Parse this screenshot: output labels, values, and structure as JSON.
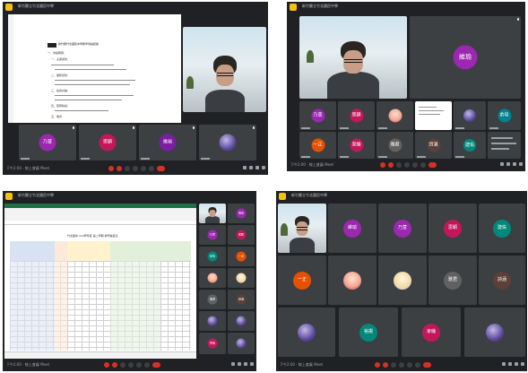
{
  "meeting": {
    "title": "新竹縣立竹北國民中學",
    "bottom_label": "下午2:00 · 線上會議 Meet"
  },
  "panels": [
    {
      "tiles": [
        {
          "initial": "乃萱",
          "color": "#9c27b0"
        },
        {
          "initial": "思穎",
          "color": "#c2185b"
        },
        {
          "initial": "維瑜",
          "color": "#7b1fa2"
        }
      ],
      "document": {
        "heading": "新竹縣竹北國民中學教學會議紀錄",
        "subheading": "一、會議時間：",
        "lines": [
          "一、主席報告：",
          "二、業務報告：",
          "三、提案討論：",
          "四、臨時動議：",
          "五、散會"
        ]
      }
    },
    {
      "big_tile": {
        "initial": "維瑜",
        "color": "#9c27b0"
      },
      "tiles": [
        {
          "initial": "乃萱",
          "color": "#9c27b0"
        },
        {
          "initial": "思穎",
          "color": "#c2185b"
        },
        {
          "initial": "一正",
          "color": "#e65100"
        },
        {
          "initial": "家綸",
          "color": "#c2185b"
        },
        {
          "initial": "雅君",
          "color": "#616161"
        },
        {
          "initial": "詩涵",
          "color": "#5d4037"
        },
        {
          "initial": "建佑",
          "color": "#00897b"
        },
        {
          "initial": "俞瑄",
          "color": "#00838f"
        }
      ]
    },
    {
      "tiles": [
        {
          "initial": "維瑜",
          "color": "#9c27b0"
        },
        {
          "initial": "乃萱",
          "color": "#9c27b0"
        },
        {
          "initial": "思穎",
          "color": "#c2185b"
        },
        {
          "initial": "建佑",
          "color": "#00897b"
        },
        {
          "initial": "一正",
          "color": "#e65100"
        },
        {
          "initial": "雅君",
          "color": "#616161"
        },
        {
          "initial": "詩涵",
          "color": "#5d4037"
        },
        {
          "initial": "家綸",
          "color": "#c2185b"
        }
      ],
      "sheet": {
        "title": "竹北國中 110學年度 第二學期 教學進度表"
      }
    },
    {
      "tiles": [
        {
          "initial": "維瑜",
          "color": "#9c27b0"
        },
        {
          "initial": "乃萱",
          "color": "#9c27b0"
        },
        {
          "initial": "思穎",
          "color": "#c2185b"
        },
        {
          "initial": "建佑",
          "color": "#00897b"
        },
        {
          "initial": "一正",
          "color": "#e65100"
        },
        {
          "initial": "雅君",
          "color": "#616161"
        },
        {
          "initial": "詩涵",
          "color": "#5d4037"
        },
        {
          "initial": "裕揚",
          "color": "#00897b"
        },
        {
          "initial": "家綸",
          "color": "#c2185b"
        }
      ]
    }
  ]
}
